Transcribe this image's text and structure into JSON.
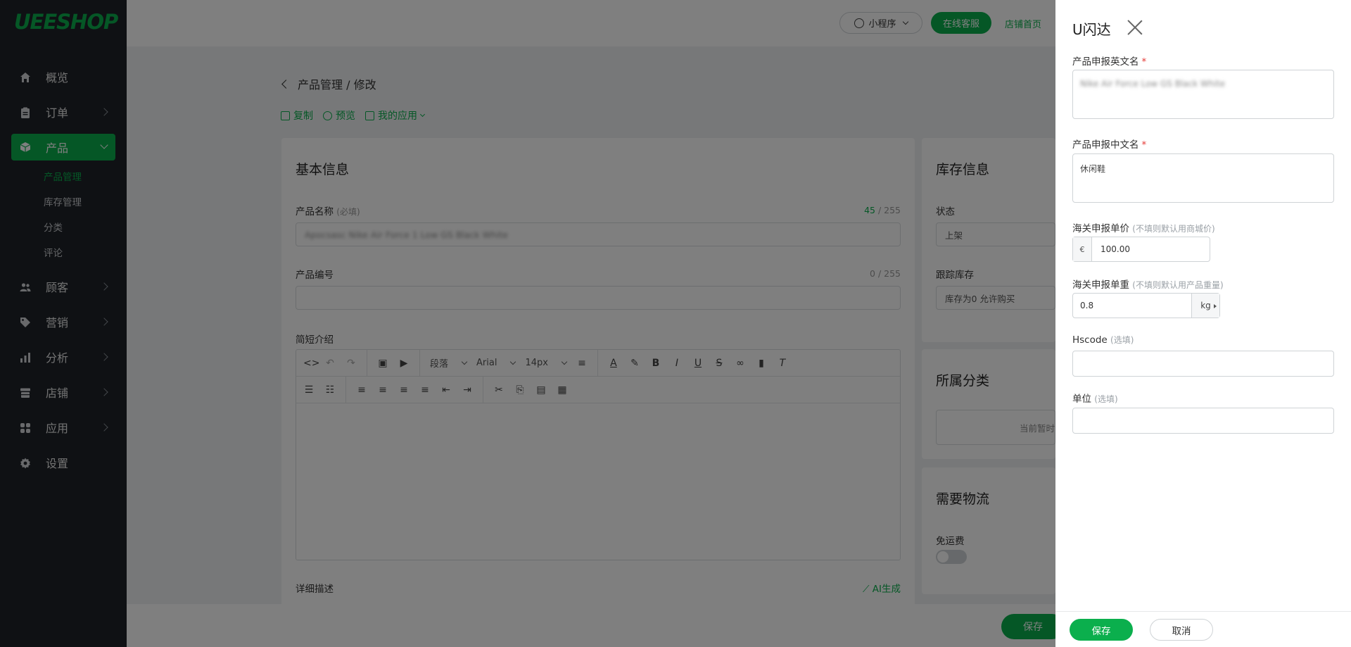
{
  "sidebar": {
    "logo": "UEESHOP",
    "items": [
      {
        "label": "概览",
        "icon": "home-icon"
      },
      {
        "label": "订单",
        "icon": "clipboard-icon"
      },
      {
        "label": "产品",
        "icon": "box-icon"
      },
      {
        "label": "顾客",
        "icon": "users-icon"
      },
      {
        "label": "营销",
        "icon": "tag-icon"
      },
      {
        "label": "分析",
        "icon": "bar-chart-icon"
      },
      {
        "label": "店铺",
        "icon": "store-icon"
      },
      {
        "label": "应用",
        "icon": "apps-icon"
      },
      {
        "label": "设置",
        "icon": "gear-icon"
      }
    ],
    "product_sub": [
      "产品管理",
      "库存管理",
      "分类",
      "评论"
    ]
  },
  "topbar": {
    "mini_program": "小程序",
    "online_service": "在线客服",
    "shop_home": "店铺首页"
  },
  "page": {
    "breadcrumb": "产品管理 / 修改",
    "actions": {
      "copy": "复制",
      "preview": "预览",
      "my_apps": "我的应用"
    },
    "basic_info": {
      "title": "基本信息",
      "name_label": "产品名称",
      "name_hint": "(必填)",
      "name_count": "45",
      "name_max": " / 255",
      "name_value": "Apocsasc Nike Air Force 1 Low GS Black White",
      "sku_label": "产品编号",
      "sku_count": "0 / 255",
      "brief_label": "简短介绍",
      "detail_label": "详细描述",
      "ai_generate": "AI生成"
    },
    "editor": {
      "paragraph": "段落",
      "font": "Arial",
      "size": "14px"
    },
    "stock": {
      "title": "库存信息",
      "status_label": "状态",
      "status_value": "上架",
      "track_label": "跟踪库存",
      "track_value": "库存为0 允许购买"
    },
    "category": {
      "title": "所属分类",
      "empty": "当前暂时"
    },
    "shipping": {
      "title": "需要物流",
      "free_label": "免运费"
    },
    "save": "保存"
  },
  "drawer": {
    "title": "U闪达",
    "en_name_label": "产品申报英文名",
    "en_name_value": "Nike Air Force Low GS Black White",
    "cn_name_label": "产品申报中文名",
    "cn_name_value": "休闲鞋",
    "price_label": "海关申报单价",
    "price_hint": "(不填则默认用商城价)",
    "currency": "€",
    "price_value": "100.00",
    "weight_label": "海关申报单重",
    "weight_hint": "(不填则默认用产品重量)",
    "weight_value": "0.8",
    "weight_unit": "kg",
    "hscode_label": "Hscode",
    "hscode_hint": "(选填)",
    "unit_label": "单位",
    "unit_hint": "(选填)",
    "required_mark": "*",
    "save": "保存",
    "cancel": "取消"
  },
  "colors": {
    "accent": "#0baf4d",
    "sidebar": "#1e2329",
    "required": "#e53935"
  }
}
